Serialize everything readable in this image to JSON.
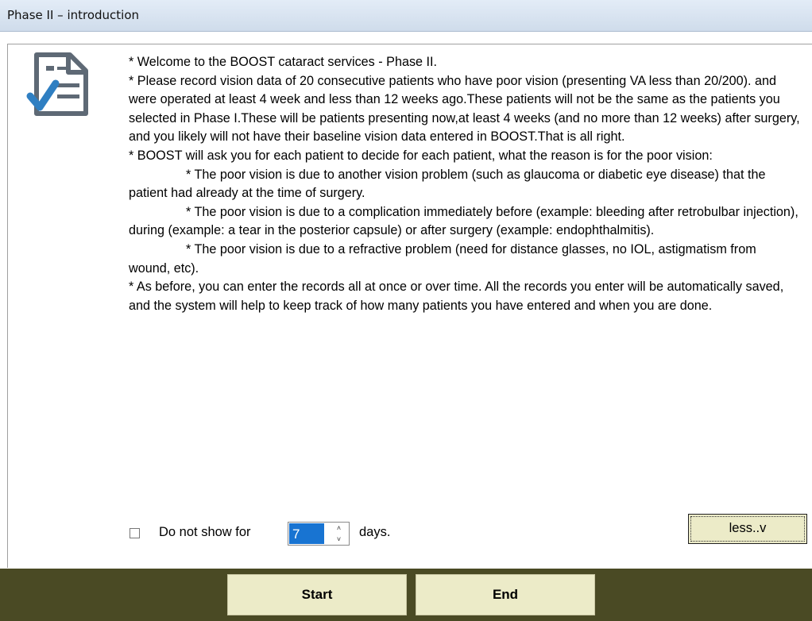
{
  "window": {
    "title": "Phase II – introduction"
  },
  "intro": {
    "paragraphs": [
      "* Welcome to the BOOST cataract services - Phase II.",
      "* Please record vision data of 20 consecutive patients who have poor vision (presenting VA less than 20/200). and were operated at least 4 week and less than 12 weeks ago.These patients will not be the same as the patients you selected in Phase I.These will be patients presenting now,at least 4 weeks (and no more than 12 weeks) after surgery, and you likely will not have their baseline vision data entered in BOOST.That is all right.",
      "* BOOST will ask you for each patient to decide for each patient, what the reason is for the poor vision:",
      "* The poor vision is due to another vision problem (such as glaucoma or diabetic eye disease) that the patient had already at the time of surgery.",
      "* The poor vision is due to a complication immediately before (example: bleeding after retrobulbar injection), during (example: a tear in the posterior capsule) or after surgery (example: endophthalmitis).",
      "* The poor vision is due to a refractive problem (need for distance glasses, no IOL, astigmatism from wound, etc).",
      "* As before, you can enter the records all at once or over time. All the records you enter will be automatically saved, and the system will help to keep track of how many patients you have entered and when you are done."
    ]
  },
  "options": {
    "checkbox_label": "Do not show for",
    "checkbox_checked": false,
    "days_value": "7",
    "days_label": "days.",
    "less_button": "less..v"
  },
  "actions": {
    "start": "Start",
    "end": "End"
  },
  "icons": {
    "document": "document-checklist-icon",
    "spin_up": "chevron-up-icon",
    "spin_down": "chevron-down-icon"
  },
  "colors": {
    "bottom_bar": "#4a4a24",
    "button_face": "#ecebc8",
    "selection": "#1874d2",
    "check_mark": "#2f7fc2"
  }
}
